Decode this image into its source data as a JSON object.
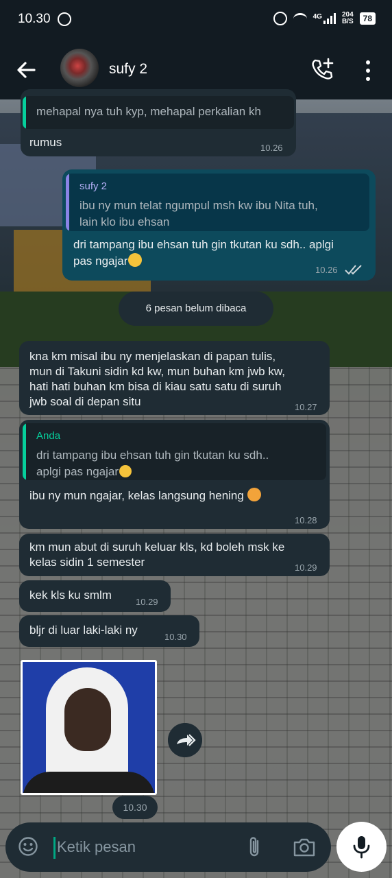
{
  "status_bar": {
    "time": "10.30",
    "network": "4G",
    "speed_value": "204",
    "speed_unit": "B/S",
    "battery": "78"
  },
  "header": {
    "contact_name": "sufy 2"
  },
  "colors": {
    "incoming_bubble": "#1f2c34",
    "outgoing_bubble": "#0d4a5c",
    "accent": "#00a884",
    "quote_bar_own": "#8a84e6",
    "quote_bar_other": "#06cf9c"
  },
  "messages": [
    {
      "quote_text": "mehapal nya tuh kyp, mehapal perkalian kh",
      "text": "rumus",
      "time": "10.26"
    },
    {
      "quote_name": "sufy 2",
      "quote_text_1": "ibu ny mun telat ngumpul msh kw ibu Nita tuh,",
      "quote_text_2": "lain klo ibu ehsan",
      "text_1": "dri tampang ibu ehsan tuh gin tkutan ku sdh.. aplgi",
      "text_2": "pas ngajar",
      "time": "10.26"
    },
    {
      "text_1": "kna km misal ibu ny menjelaskan di papan tulis,",
      "text_2": "mun di Takuni sidin kd kw, mun buhan km jwb kw,",
      "text_3": "hati hati buhan km bisa di kiau satu satu di suruh",
      "text_4": "jwb soal di depan situ",
      "time": "10.27"
    },
    {
      "quote_name": "Anda",
      "quote_text_1": "dri tampang ibu ehsan tuh gin tkutan ku sdh..",
      "quote_text_2": "aplgi pas ngajar",
      "text": "ibu ny mun ngajar, kelas langsung hening",
      "time": "10.28"
    },
    {
      "text_1": "km mun abut di suruh keluar kls, kd boleh msk ke",
      "text_2": "kelas sidin 1 semester",
      "time": "10.29"
    },
    {
      "text": "kek kls ku smlm",
      "time": "10.29"
    },
    {
      "text": "bljr di luar laki-laki ny",
      "time": "10.30"
    },
    {
      "image_time": "10.30"
    }
  ],
  "unread_label": "6 pesan belum dibaca",
  "input": {
    "placeholder": "Ketik pesan"
  }
}
